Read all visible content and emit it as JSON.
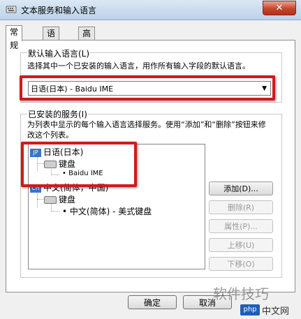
{
  "window": {
    "title": "文本服务和输入语言",
    "close_symbol": "✕"
  },
  "tabs": [
    {
      "label": "常规"
    },
    {
      "label": "语言栏"
    },
    {
      "label": "高级键设置"
    }
  ],
  "default_language": {
    "label": "默认输入语言(L)",
    "description": "选择其中一个已安装的输入语言，用作所有输入字段的默认语言。",
    "selected": "日语(日本) - Baidu IME"
  },
  "installed_services": {
    "label": "已安装的服务(I)",
    "description": "为列表中显示的每个输入语言选择服务。使用“添加”和“删除”按钮来修改这个列表。",
    "tree": [
      {
        "badge": "JP",
        "language": "日语(日本)",
        "group": "键盘",
        "item": "Baidu IME"
      },
      {
        "badge": "CH",
        "language": "中文(简体，中国)",
        "group": "键盘",
        "item": "中文(简体) - 美式键盘"
      }
    ],
    "item_bullet": "•"
  },
  "buttons": {
    "add": "添加(D)...",
    "remove": "删除(R)",
    "properties": "属性(P)...",
    "move_up": "上移(U)",
    "move_down": "下移(O)"
  },
  "footer": {
    "ok": "确定",
    "cancel": "取消"
  },
  "watermark": {
    "text": "软件技巧",
    "badge": "php",
    "site": "中文网"
  }
}
